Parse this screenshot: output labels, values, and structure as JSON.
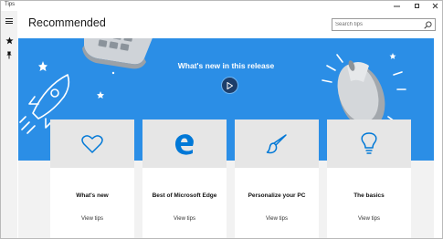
{
  "window": {
    "app_title": "Tips"
  },
  "header": {
    "title": "Recommended"
  },
  "search": {
    "placeholder": "Search tips"
  },
  "hero": {
    "title": "What's new in this release"
  },
  "cards": [
    {
      "title": "What's new",
      "link": "View tips",
      "icon": "heart-icon"
    },
    {
      "title": "Best of Microsoft Edge",
      "link": "View tips",
      "icon": "edge-logo-icon"
    },
    {
      "title": "Personalize your PC",
      "link": "View tips",
      "icon": "paintbrush-icon"
    },
    {
      "title": "The basics",
      "link": "View tips",
      "icon": "lightbulb-icon"
    }
  ],
  "colors": {
    "accent": "#0078d7",
    "hero_background": "#2b8ee6",
    "card_top": "#e6e6e6"
  }
}
